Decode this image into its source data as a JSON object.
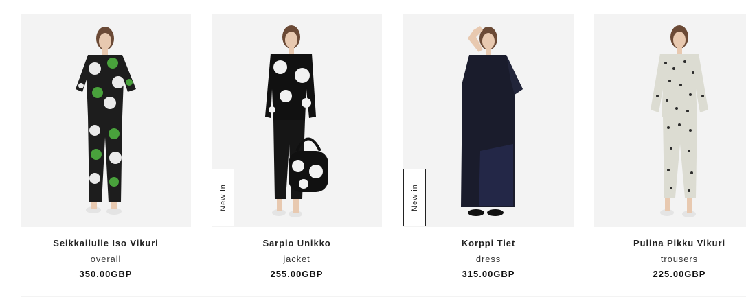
{
  "products": [
    {
      "name": "Seikkailulle Iso Vikuri",
      "type": "overall",
      "price": "350.00GBP",
      "badge": ""
    },
    {
      "name": "Sarpio Unikko",
      "type": "jacket",
      "price": "255.00GBP",
      "badge": "New in"
    },
    {
      "name": "Korppi Tiet",
      "type": "dress",
      "price": "315.00GBP",
      "badge": "New in"
    },
    {
      "name": "Pulina Pikku Vikuri",
      "type": "trousers",
      "price": "225.00GBP",
      "badge": ""
    }
  ],
  "colors": {
    "card_bg": "#f3f3f3",
    "text": "#222222"
  }
}
